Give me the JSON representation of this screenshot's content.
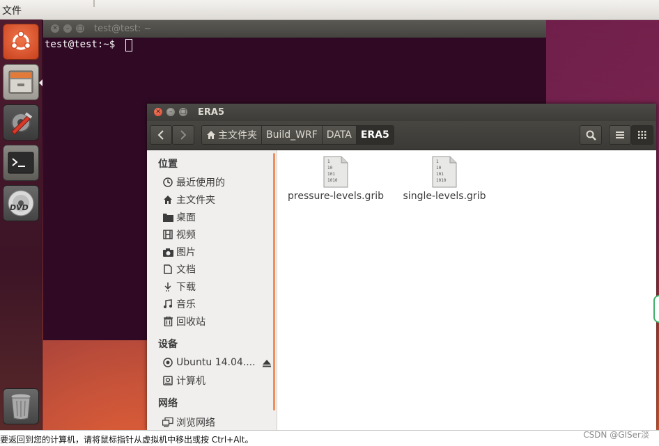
{
  "top_panel": {
    "app_menu": "文件"
  },
  "launcher": {
    "items": [
      {
        "name": "ubuntu-dash-icon"
      },
      {
        "name": "file-manager-icon"
      },
      {
        "name": "system-settings-icon"
      },
      {
        "name": "terminal-icon"
      },
      {
        "name": "dvd-icon"
      },
      {
        "name": "trash-icon"
      }
    ]
  },
  "terminal": {
    "title": "test@test: ~",
    "prompt": "test@test:~$ "
  },
  "files": {
    "title": "ERA5",
    "breadcrumbs": [
      {
        "label": "主文件夹",
        "icon": "home-icon"
      },
      {
        "label": "Build_WRF"
      },
      {
        "label": "DATA"
      },
      {
        "label": "ERA5",
        "active": true
      }
    ],
    "sidebar": {
      "places_heading": "位置",
      "places": [
        {
          "label": "最近使用的",
          "icon": "clock-icon"
        },
        {
          "label": "主文件夹",
          "icon": "home-icon"
        },
        {
          "label": "桌面",
          "icon": "folder-icon"
        },
        {
          "label": "视频",
          "icon": "film-icon"
        },
        {
          "label": "图片",
          "icon": "camera-icon"
        },
        {
          "label": "文档",
          "icon": "document-icon"
        },
        {
          "label": "下载",
          "icon": "download-icon"
        },
        {
          "label": "音乐",
          "icon": "music-icon"
        },
        {
          "label": "回收站",
          "icon": "trash-icon"
        }
      ],
      "devices_heading": "设备",
      "devices": [
        {
          "label": "Ubuntu 14.04....",
          "icon": "disc-icon"
        },
        {
          "label": "计算机",
          "icon": "computer-icon"
        }
      ],
      "network_heading": "网络",
      "network": [
        {
          "label": "浏览网络",
          "icon": "network-icon"
        }
      ]
    },
    "files": [
      {
        "name": "pressure-levels.grib",
        "icon": "binary-file-icon",
        "glyph": [
          "1",
          "10",
          "101",
          "1010"
        ]
      },
      {
        "name": "single-levels.grib",
        "icon": "binary-file-icon",
        "glyph": [
          "1",
          "10",
          "101",
          "1010"
        ]
      }
    ]
  },
  "status_bar": {
    "message": "要返回到您的计算机，请将鼠标指针从虚拟机中移出或按 Ctrl+Alt。",
    "watermark": "CSDN @GISer淡"
  },
  "colors": {
    "terminal_bg": "#300a24",
    "accent_orange": "#ef8f5f",
    "close_button": "#d6432a"
  }
}
